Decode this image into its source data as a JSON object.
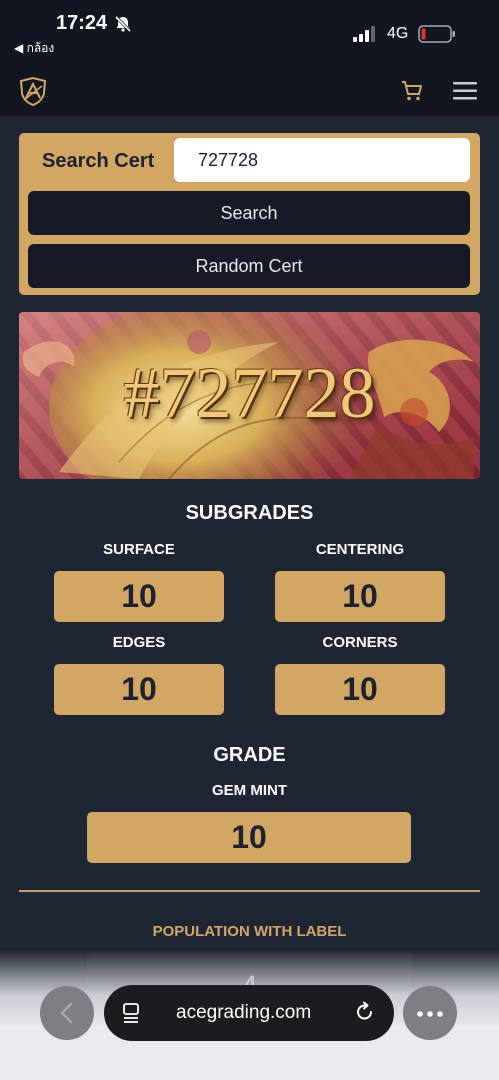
{
  "status_bar": {
    "time": "17:24",
    "back_app": "◀ กล้อง",
    "network": "4G"
  },
  "navbar": {
    "logo_icon": "ace-shield-logo-icon",
    "cart_icon": "cart-icon",
    "menu_icon": "hamburger-menu-icon"
  },
  "search": {
    "label": "Search Cert",
    "value": "727728",
    "search_button": "Search",
    "random_button": "Random Cert"
  },
  "banner": {
    "cert_number": "#727728"
  },
  "subgrades": {
    "title": "SUBGRADES",
    "surface_label": "SURFACE",
    "surface_value": "10",
    "centering_label": "CENTERING",
    "centering_value": "10",
    "edges_label": "EDGES",
    "edges_value": "10",
    "corners_label": "CORNERS",
    "corners_value": "10"
  },
  "grade": {
    "title": "GRADE",
    "label": "GEM MINT",
    "value": "10"
  },
  "population": {
    "label": "POPULATION WITH LABEL",
    "value": "4"
  },
  "browser": {
    "url": "acegrading.com"
  },
  "colors": {
    "background": "#1f2633",
    "accent_gold": "#d2a764",
    "button_dark": "#161a26"
  }
}
